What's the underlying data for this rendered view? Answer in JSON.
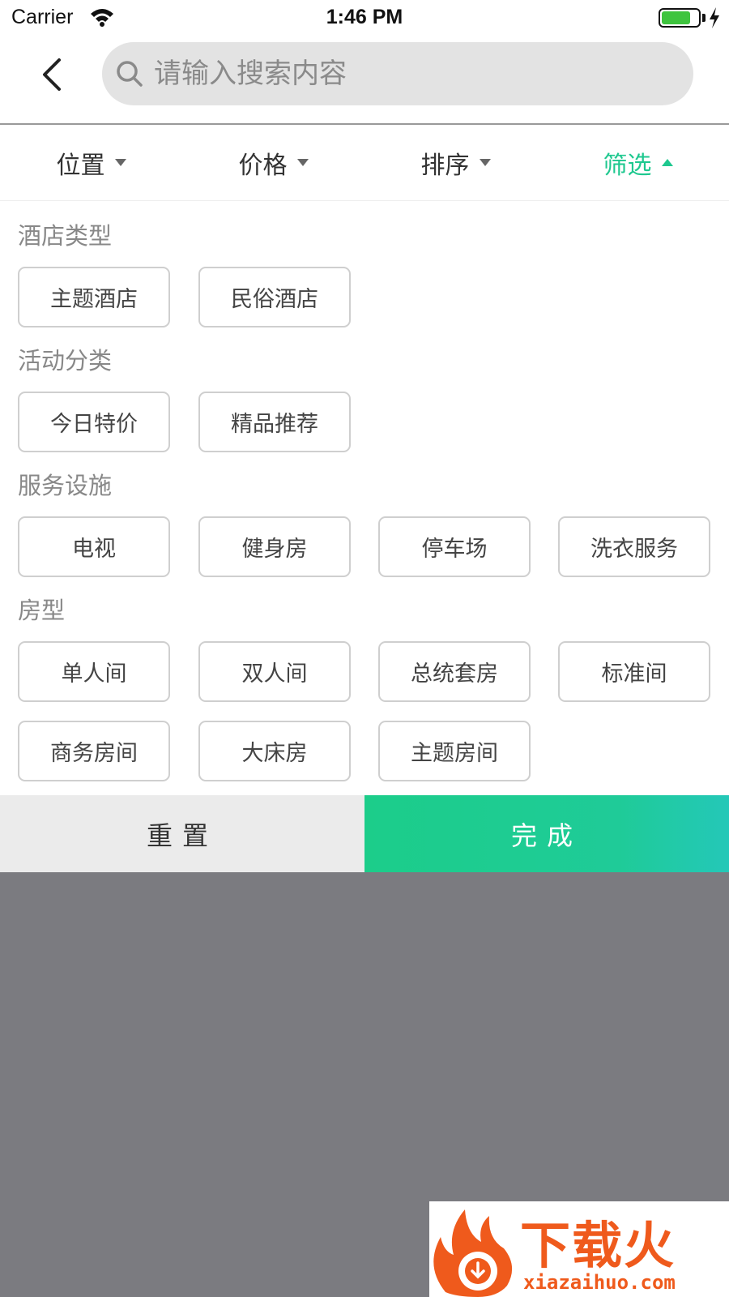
{
  "status_bar": {
    "carrier": "Carrier",
    "time": "1:46 PM"
  },
  "search": {
    "placeholder": "请输入搜索内容"
  },
  "filter_tabs": [
    {
      "label": "位置",
      "active": false
    },
    {
      "label": "价格",
      "active": false
    },
    {
      "label": "排序",
      "active": false
    },
    {
      "label": "筛选",
      "active": true
    }
  ],
  "sections": [
    {
      "title": "酒店类型",
      "options": [
        "主题酒店",
        "民俗酒店"
      ]
    },
    {
      "title": "活动分类",
      "options": [
        "今日特价",
        "精品推荐"
      ]
    },
    {
      "title": "服务设施",
      "options": [
        "电视",
        "健身房",
        "停车场",
        "洗衣服务"
      ]
    },
    {
      "title": "房型",
      "options": [
        "单人间",
        "双人间",
        "总统套房",
        "标准间",
        "商务房间",
        "大床房",
        "主题房间"
      ]
    }
  ],
  "actions": {
    "reset": "重置",
    "done": "完成"
  },
  "watermark": {
    "brand": "下载火",
    "url": "xiazaihuo.com"
  },
  "colors": {
    "accent": "#1ec88f",
    "overlay": "#7b7b80",
    "chip_border": "#cfcfcf"
  }
}
